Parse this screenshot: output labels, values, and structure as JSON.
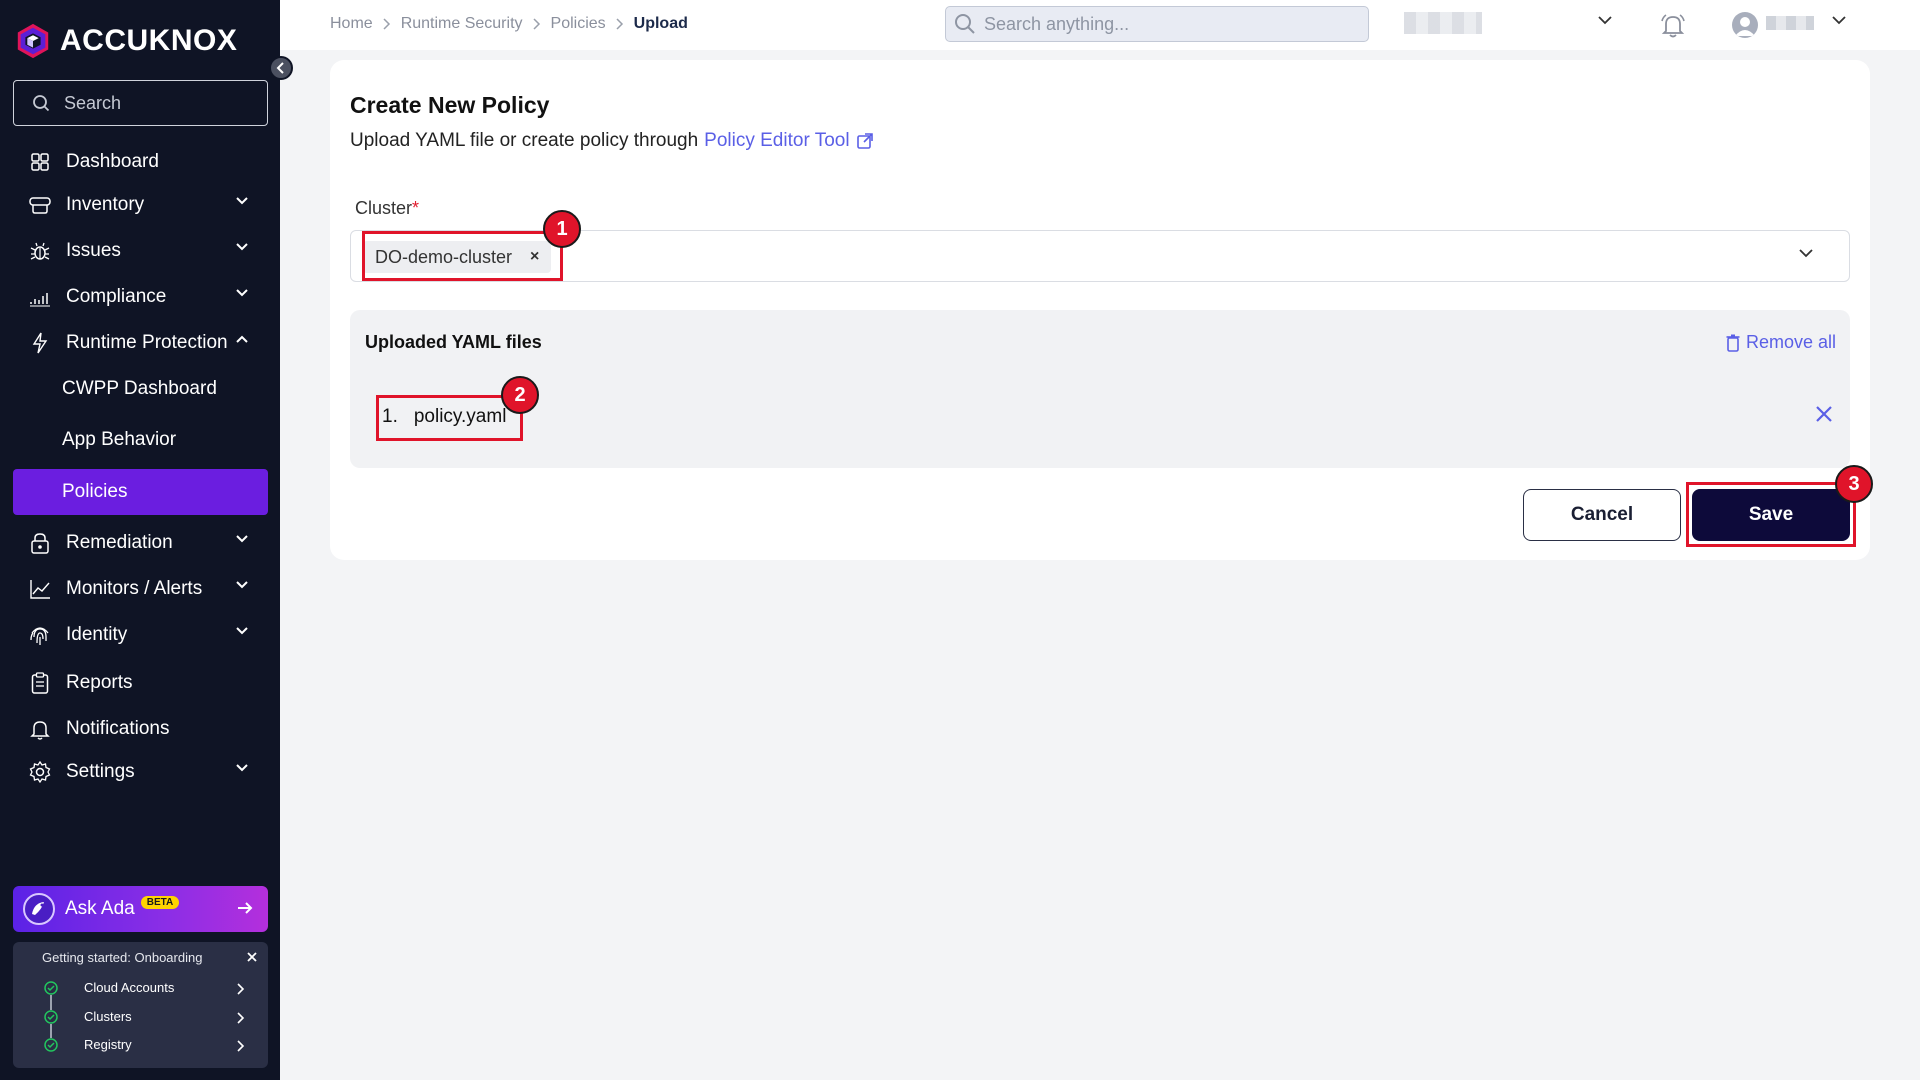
{
  "brand": {
    "name": "ACCUKNOX"
  },
  "sidebar": {
    "search_placeholder": "Search",
    "items": [
      {
        "label": "Dashboard",
        "icon": "dashboard-icon"
      },
      {
        "label": "Inventory",
        "icon": "inventory-icon"
      },
      {
        "label": "Issues",
        "icon": "bug-icon"
      },
      {
        "label": "Compliance",
        "icon": "bar-chart-icon"
      },
      {
        "label": "Runtime Protection",
        "icon": "bolt-icon"
      },
      {
        "label": "Remediation",
        "icon": "lock-icon"
      },
      {
        "label": "Monitors / Alerts",
        "icon": "line-chart-icon"
      },
      {
        "label": "Identity",
        "icon": "fingerprint-icon"
      },
      {
        "label": "Reports",
        "icon": "clipboard-icon"
      },
      {
        "label": "Notifications",
        "icon": "bell-icon"
      },
      {
        "label": "Settings",
        "icon": "gear-icon"
      }
    ],
    "subitems": [
      {
        "label": "CWPP Dashboard"
      },
      {
        "label": "App Behavior"
      },
      {
        "label": "Policies",
        "active": true
      }
    ],
    "ask_ada": {
      "label": "Ask Ada",
      "badge": "BETA"
    },
    "onboarding": {
      "title": "Getting started: Onboarding",
      "steps": [
        {
          "label": "Cloud Accounts"
        },
        {
          "label": "Clusters"
        },
        {
          "label": "Registry"
        }
      ]
    }
  },
  "topbar": {
    "breadcrumbs": [
      "Home",
      "Runtime Security",
      "Policies",
      "Upload"
    ],
    "search_placeholder": "Search anything..."
  },
  "main": {
    "title": "Create New Policy",
    "subtitle": "Upload YAML file or create policy through",
    "link": "Policy Editor Tool",
    "cluster_label": "Cluster",
    "required_mark": "*",
    "cluster_selected": "DO-demo-cluster",
    "chip_remove": "×",
    "uploads_title": "Uploaded YAML files",
    "remove_all": "Remove all",
    "files": [
      {
        "index": "1.",
        "name": "policy.yaml"
      }
    ],
    "cancel": "Cancel",
    "save": "Save"
  },
  "annotations": [
    "1",
    "2",
    "3"
  ],
  "colors": {
    "sidebar_bg": "#0f1425",
    "active": "#6b1ee0",
    "link": "#5a5fe6",
    "primary_btn": "#0d0a3a",
    "highlight": "#e0142a"
  }
}
